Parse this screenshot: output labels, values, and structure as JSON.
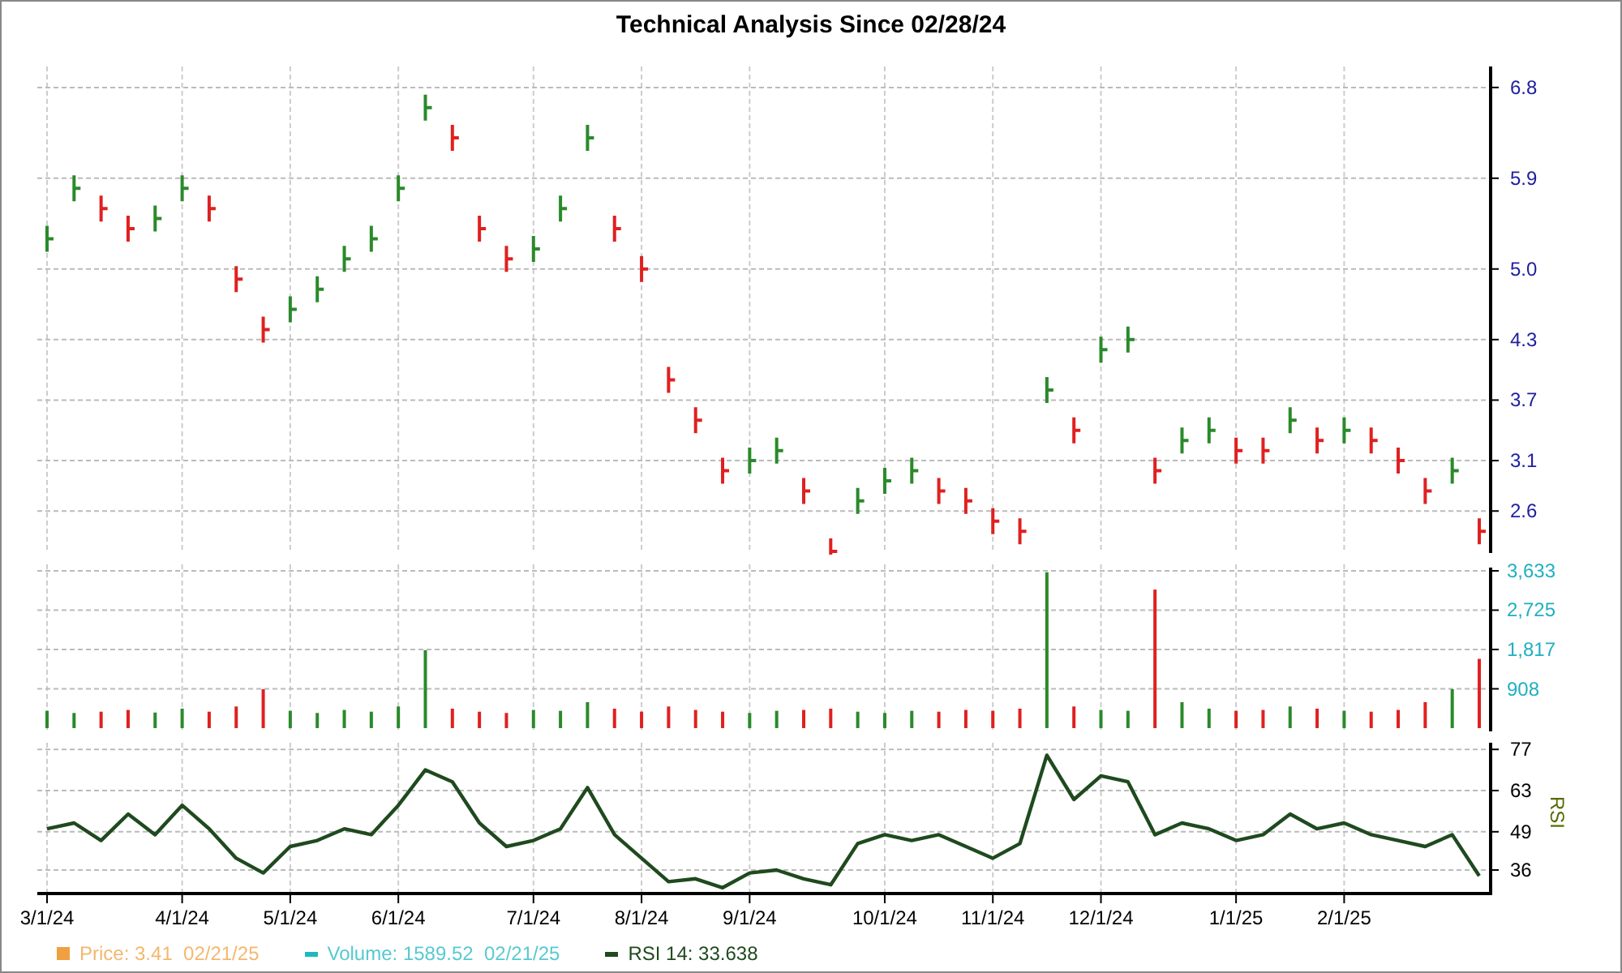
{
  "title": "Technical Analysis Since 02/28/24",
  "price_panel": {
    "chart_data": {
      "type": "scatter",
      "grid": true,
      "ylim": [
        2.2,
        7.0
      ],
      "yticks": [
        {
          "value": 2.6,
          "label": "2.6"
        },
        {
          "value": 3.1,
          "label": "3.1"
        },
        {
          "value": 3.7,
          "label": "3.7"
        },
        {
          "value": 4.3,
          "label": "4.3"
        },
        {
          "value": 5,
          "label": "5.0"
        },
        {
          "value": 5.9,
          "label": "5.9"
        },
        {
          "value": 6.8,
          "label": "6.8"
        }
      ],
      "series": [
        {
          "color": "#2a8a2a",
          "values": [
            5.3,
            5.8,
            null,
            null,
            5.5,
            5.8,
            null,
            null,
            null,
            4.6,
            4.8,
            5.1,
            5.3,
            5.8,
            6.6,
            null,
            null,
            null,
            5.2,
            5.6,
            6.3,
            null,
            null,
            null,
            null,
            null,
            3.1,
            3.2,
            null,
            null,
            2.7,
            2.9,
            3.0,
            null,
            null,
            null,
            null,
            3.8,
            null,
            4.2,
            4.3,
            null,
            3.3,
            3.4,
            null,
            null,
            3.5,
            null,
            3.4,
            null,
            null,
            null,
            3.0,
            null
          ]
        },
        {
          "color": "#e02020",
          "values": [
            null,
            null,
            5.6,
            5.4,
            null,
            null,
            5.6,
            4.9,
            4.4,
            null,
            null,
            null,
            null,
            null,
            null,
            6.3,
            5.4,
            5.1,
            null,
            null,
            null,
            5.4,
            5.0,
            3.9,
            3.5,
            3.0,
            null,
            null,
            2.8,
            2.2,
            null,
            null,
            null,
            2.8,
            2.7,
            2.5,
            2.4,
            null,
            3.4,
            null,
            null,
            3.0,
            null,
            null,
            3.2,
            3.2,
            null,
            3.3,
            null,
            3.3,
            3.1,
            2.8,
            null,
            2.4
          ]
        }
      ]
    }
  },
  "volume_panel": {
    "chart_data": {
      "type": "bar",
      "grid": true,
      "ylim": [
        0,
        3633
      ],
      "yticks": [
        {
          "value": 908,
          "label": "908"
        },
        {
          "value": 1817,
          "label": "1,817"
        },
        {
          "value": 2725,
          "label": "2,725"
        },
        {
          "value": 3633,
          "label": "3,633"
        }
      ],
      "series": [
        {
          "values": [
            400,
            350,
            380,
            420,
            360,
            450,
            380,
            500,
            900,
            400,
            350,
            420,
            380,
            500,
            1800,
            450,
            380,
            350,
            420,
            400,
            600,
            450,
            380,
            500,
            420,
            380,
            350,
            400,
            420,
            450,
            380,
            350,
            400,
            380,
            420,
            400,
            450,
            3600,
            500,
            420,
            400,
            3200,
            600,
            450,
            400,
            420,
            500,
            450,
            400,
            380,
            420,
            600,
            900,
            1600
          ]
        }
      ]
    }
  },
  "rsi_panel": {
    "chart_data": {
      "type": "line",
      "grid": true,
      "ylim": [
        28,
        78
      ],
      "yticks": [
        36,
        49,
        63,
        77
      ],
      "ylabel": "RSI",
      "categories": [
        "3/1/24",
        null,
        null,
        null,
        null,
        "4/1/24",
        null,
        null,
        null,
        "5/1/24",
        null,
        null,
        null,
        "6/1/24",
        null,
        null,
        null,
        null,
        "7/1/24",
        null,
        null,
        null,
        "8/1/24",
        null,
        null,
        null,
        "9/1/24",
        null,
        null,
        null,
        null,
        "10/1/24",
        null,
        null,
        null,
        "11/1/24",
        null,
        null,
        null,
        "12/1/24",
        null,
        null,
        null,
        null,
        "1/1/25",
        null,
        null,
        null,
        "2/1/25",
        null,
        null,
        null,
        null,
        null
      ],
      "series": [
        {
          "color": "#1f4a1f",
          "values": [
            50,
            52,
            46,
            55,
            48,
            58,
            50,
            40,
            35,
            44,
            46,
            50,
            48,
            58,
            70,
            66,
            52,
            44,
            46,
            50,
            64,
            48,
            40,
            32,
            33,
            30,
            35,
            36,
            33,
            31,
            45,
            48,
            46,
            48,
            44,
            40,
            45,
            75,
            60,
            68,
            66,
            48,
            52,
            50,
            46,
            48,
            55,
            50,
            52,
            48,
            46,
            44,
            48,
            34
          ]
        }
      ]
    }
  },
  "legend": [
    {
      "label": "Price: 3.41  02/21/25",
      "color": "#f0a040"
    },
    {
      "label": "Volume: 1589.52  02/21/25",
      "color": "#20b8c0"
    },
    {
      "label": "RSI 14: 33.638",
      "color": "#1f4a1f"
    }
  ]
}
